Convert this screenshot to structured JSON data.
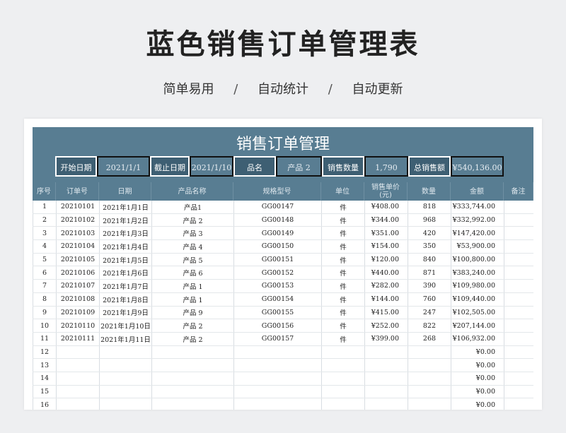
{
  "page": {
    "title": "蓝色销售订单管理表",
    "subtitle": [
      "简单易用",
      "自动统计",
      "自动更新"
    ],
    "separator": "/"
  },
  "sheet": {
    "title": "销售订单管理",
    "filters": [
      {
        "label": "开始日期",
        "value": "2021/1/1"
      },
      {
        "label": "截止日期",
        "value": "2021/1/10"
      },
      {
        "label": "品名",
        "value": "产品 2"
      },
      {
        "label": "销售数量",
        "value": "1,790"
      },
      {
        "label": "总销售额",
        "value": "¥540,136.00"
      }
    ],
    "columns": [
      "序号",
      "订单号",
      "日期",
      "产品名称",
      "规格型号",
      "单位",
      "销售单价\n(元)",
      "数量",
      "金额",
      "备注"
    ],
    "rows": [
      [
        "1",
        "20210101",
        "2021年1月1日",
        "产品1",
        "GG00147",
        "件",
        "¥408.00",
        "818",
        "¥333,744.00",
        ""
      ],
      [
        "2",
        "20210102",
        "2021年1月2日",
        "产品 2",
        "GG00148",
        "件",
        "¥344.00",
        "968",
        "¥332,992.00",
        ""
      ],
      [
        "3",
        "20210103",
        "2021年1月3日",
        "产品 3",
        "GG00149",
        "件",
        "¥351.00",
        "420",
        "¥147,420.00",
        ""
      ],
      [
        "4",
        "20210104",
        "2021年1月4日",
        "产品 4",
        "GG00150",
        "件",
        "¥154.00",
        "350",
        "¥53,900.00",
        ""
      ],
      [
        "5",
        "20210105",
        "2021年1月5日",
        "产品 5",
        "GG00151",
        "件",
        "¥120.00",
        "840",
        "¥100,800.00",
        ""
      ],
      [
        "6",
        "20210106",
        "2021年1月6日",
        "产品 6",
        "GG00152",
        "件",
        "¥440.00",
        "871",
        "¥383,240.00",
        ""
      ],
      [
        "7",
        "20210107",
        "2021年1月7日",
        "产品 1",
        "GG00153",
        "件",
        "¥282.00",
        "390",
        "¥109,980.00",
        ""
      ],
      [
        "8",
        "20210108",
        "2021年1月8日",
        "产品 1",
        "GG00154",
        "件",
        "¥144.00",
        "760",
        "¥109,440.00",
        ""
      ],
      [
        "9",
        "20210109",
        "2021年1月9日",
        "产品 9",
        "GG00155",
        "件",
        "¥415.00",
        "247",
        "¥102,505.00",
        ""
      ],
      [
        "10",
        "20210110",
        "2021年1月10日",
        "产品 2",
        "GG00156",
        "件",
        "¥252.00",
        "822",
        "¥207,144.00",
        ""
      ],
      [
        "11",
        "20210111",
        "2021年1月11日",
        "产品 2",
        "GG00157",
        "件",
        "¥399.00",
        "268",
        "¥106,932.00",
        ""
      ],
      [
        "12",
        "",
        "",
        "",
        "",
        "",
        "",
        "",
        "¥0.00",
        ""
      ],
      [
        "13",
        "",
        "",
        "",
        "",
        "",
        "",
        "",
        "¥0.00",
        ""
      ],
      [
        "14",
        "",
        "",
        "",
        "",
        "",
        "",
        "",
        "¥0.00",
        ""
      ],
      [
        "15",
        "",
        "",
        "",
        "",
        "",
        "",
        "",
        "¥0.00",
        ""
      ],
      [
        "16",
        "",
        "",
        "",
        "",
        "",
        "",
        "",
        "¥0.00",
        ""
      ]
    ]
  },
  "colors": {
    "header_bg": "#587d92",
    "label_bg": "#3e5f73",
    "page_bg": "#eeeff1"
  }
}
